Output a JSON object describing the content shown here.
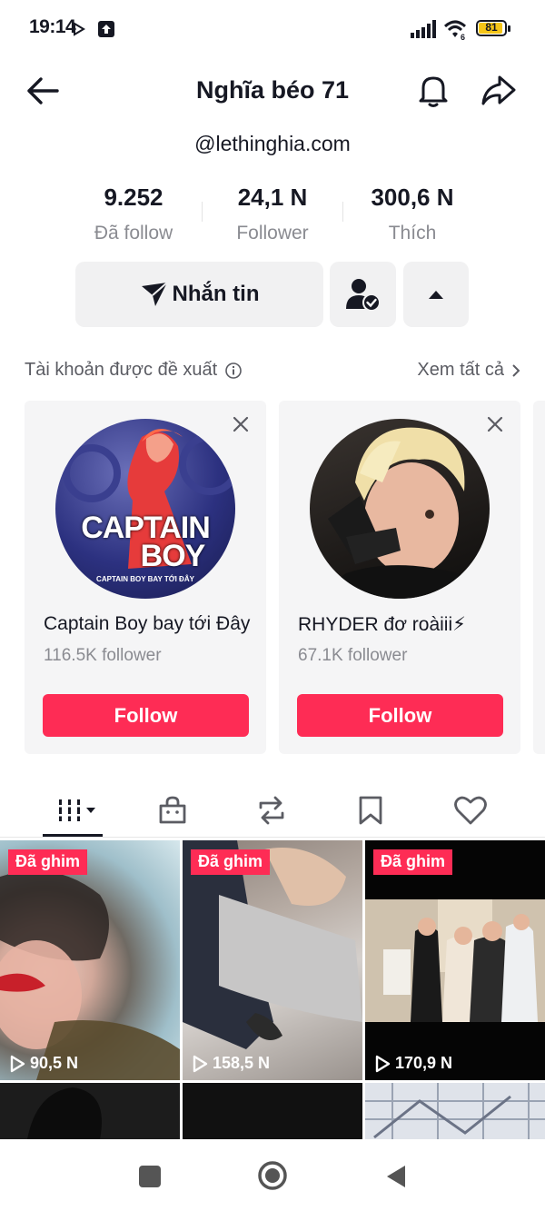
{
  "status": {
    "time": "19:14",
    "battery": "81"
  },
  "header": {
    "title": "Nghĩa béo 71",
    "handle": "@lethinghia.com"
  },
  "stats": [
    {
      "value": "9.252",
      "label": "Đã follow"
    },
    {
      "value": "24,1 N",
      "label": "Follower"
    },
    {
      "value": "300,6 N",
      "label": "Thích"
    }
  ],
  "actions": {
    "message_label": "Nhắn tin"
  },
  "suggested": {
    "title": "Tài khoản được đề xuất",
    "see_all": "Xem tất cả",
    "cards": [
      {
        "name": "Captain Boy bay tới Đây",
        "followers": "116.5K follower",
        "button": "Follow",
        "avatar_text_1": "CAPTAIN",
        "avatar_text_2": "BOY",
        "avatar_caption": "CAPTAIN BOY BAY TỚI ĐÂY"
      },
      {
        "name": "RHYDER đơ roàiii⚡",
        "followers": "67.1K follower",
        "button": "Follow"
      }
    ]
  },
  "videos": [
    {
      "badge": "Đã ghim",
      "views": "90,5 N"
    },
    {
      "badge": "Đã ghim",
      "views": "158,5 N"
    },
    {
      "badge": "Đã ghim",
      "views": "170,9 N"
    }
  ],
  "colors": {
    "accent": "#fe2c55",
    "text": "#161823",
    "secondary": "#8a8b91"
  }
}
